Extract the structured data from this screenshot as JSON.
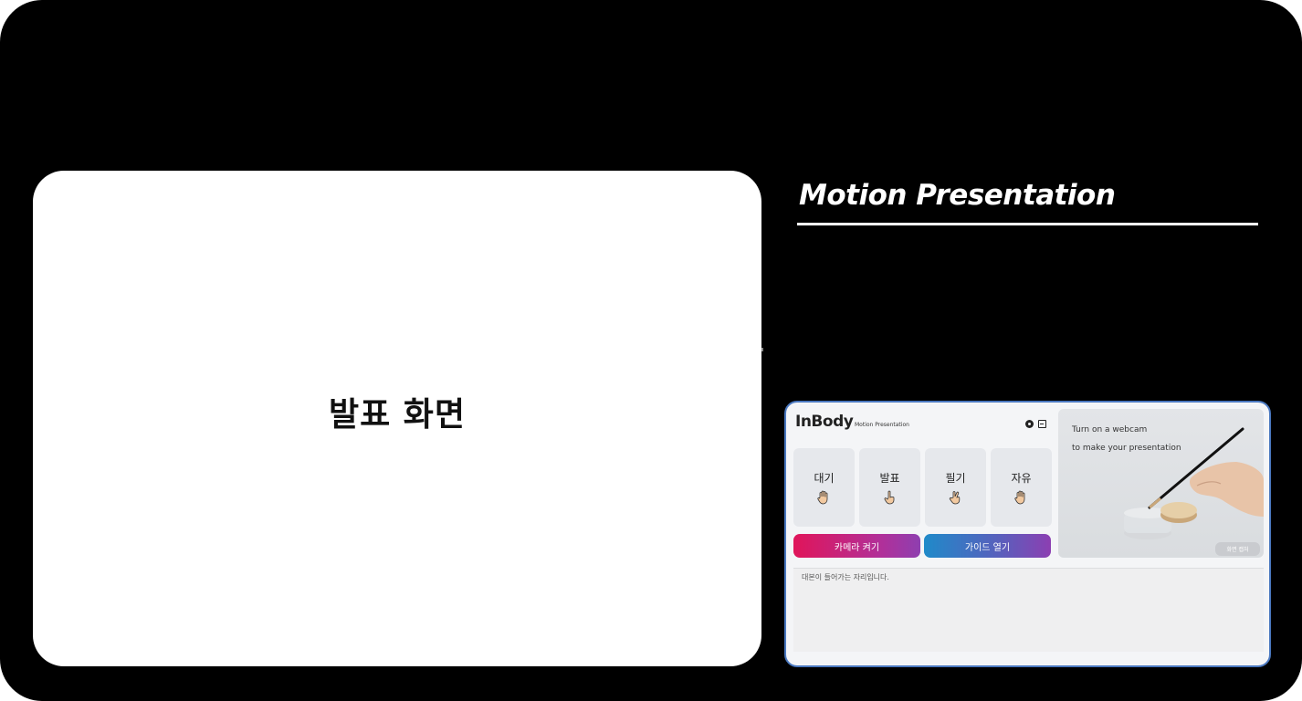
{
  "presentation_screen": {
    "label": "발표 화면"
  },
  "title": "Motion Presentation",
  "app": {
    "logo": "InBody",
    "logo_subtitle": "Motion Presentation",
    "icons": {
      "settings": "gear-icon",
      "exit": "exit-icon"
    },
    "modes": [
      {
        "label": "대기",
        "icon": "open-hand-icon"
      },
      {
        "label": "발표",
        "icon": "pointing-hand-icon"
      },
      {
        "label": "필기",
        "icon": "writing-hand-icon"
      },
      {
        "label": "자유",
        "icon": "open-hand-icon"
      }
    ],
    "camera_button": "카메라 켜기",
    "guide_button": "가이드 열기",
    "webcam": {
      "line1": "Turn on a webcam",
      "line2": "to make your presentation",
      "capture_button": "화면 캡처"
    },
    "script_placeholder": "대본이 들어가는 자리입니다."
  },
  "colors": {
    "camera_button_start": "#e0155a",
    "camera_button_end": "#8e3fb0",
    "guide_button_start": "#1f8ac9",
    "guide_button_end": "#8c3fb2",
    "panel_border": "#4a78c0"
  }
}
